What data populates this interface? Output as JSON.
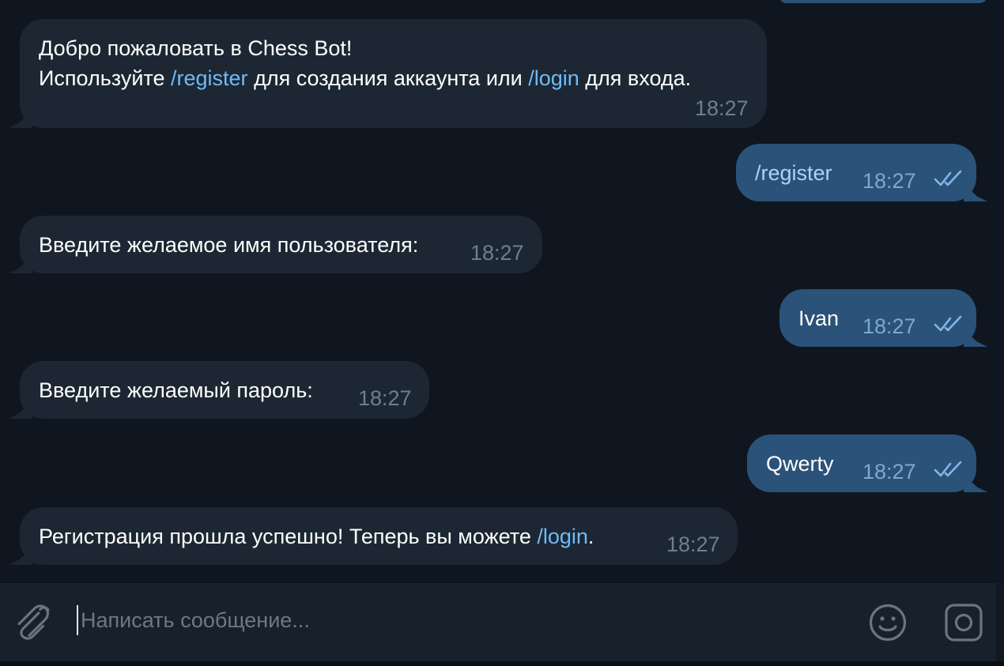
{
  "chat": {
    "messages": [
      {
        "direction": "in",
        "line1": "Добро пожаловать в Chess Bot!",
        "line2_pre": "Используйте ",
        "line2_cmd1": "/register",
        "line2_mid": " для создания аккаунта или ",
        "line2_cmd2": "/login",
        "line2_post": " для входа.",
        "time": "18:27"
      },
      {
        "direction": "out",
        "text": "/register",
        "time": "18:27",
        "status": "read"
      },
      {
        "direction": "in",
        "text": "Введите желаемое имя пользователя:",
        "time": "18:27"
      },
      {
        "direction": "out",
        "text": "Ivan",
        "time": "18:27",
        "status": "read"
      },
      {
        "direction": "in",
        "text": "Введите желаемый пароль:",
        "time": "18:27"
      },
      {
        "direction": "out",
        "text": "Qwerty",
        "time": "18:27",
        "status": "read"
      },
      {
        "direction": "in",
        "pre": "Регистрация прошла успешно! Теперь вы можете ",
        "cmd": "/login",
        "post": ".",
        "time": "18:27"
      }
    ]
  },
  "composer": {
    "placeholder": "Написать сообщение...",
    "value": "",
    "icons": [
      "paperclip-icon",
      "emoji-icon",
      "camera-icon"
    ]
  },
  "colors": {
    "background": "#0e1621",
    "incoming_bubble": "#1c2733",
    "outgoing_bubble": "#2b5278",
    "link": "#71baf7",
    "composer": "#17212b"
  }
}
